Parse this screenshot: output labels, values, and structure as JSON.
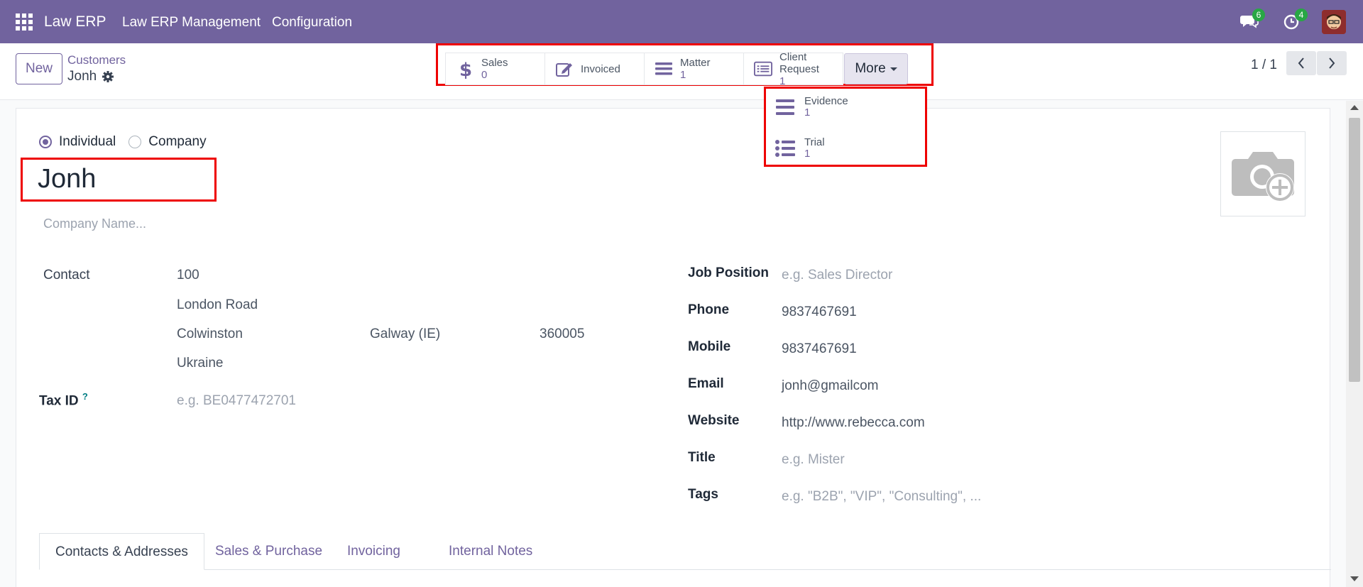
{
  "topnav": {
    "brand": "Law ERP",
    "menu": [
      "Law ERP Management",
      "Configuration"
    ],
    "messages_count": "6",
    "activities_count": "4"
  },
  "control_panel": {
    "new_label": "New",
    "breadcrumb_parent": "Customers",
    "breadcrumb_current": "Jonh",
    "pager": "1 / 1"
  },
  "smart_buttons": [
    {
      "label": "Sales",
      "count": "0",
      "icon": "dollar-icon"
    },
    {
      "label": "Invoiced",
      "count": "",
      "icon": "pencil-square-icon"
    },
    {
      "label": "Matter",
      "count": "1",
      "icon": "bars-icon"
    },
    {
      "label": "Client Request",
      "count": "1",
      "icon": "list-alt-icon"
    }
  ],
  "more_label": "More",
  "dropdown": [
    {
      "label": "Evidence",
      "count": "1",
      "icon": "bars-icon"
    },
    {
      "label": "Trial",
      "count": "1",
      "icon": "list-ul-icon"
    }
  ],
  "form": {
    "type_options": [
      "Individual",
      "Company"
    ],
    "selected_type": "Individual",
    "name": "Jonh",
    "company_placeholder": "Company Name...",
    "contact_label": "Contact",
    "street": "100",
    "street2": "London Road",
    "city": "Colwinston",
    "state": "Galway (IE)",
    "zip": "360005",
    "country": "Ukraine",
    "tax_label": "Tax ID",
    "tax_help": "?",
    "tax_placeholder": "e.g. BE0477472701",
    "right_fields": [
      {
        "label": "Job Position",
        "value": "",
        "placeholder": "e.g. Sales Director"
      },
      {
        "label": "Phone",
        "value": "9837467691",
        "placeholder": ""
      },
      {
        "label": "Mobile",
        "value": "9837467691",
        "placeholder": ""
      },
      {
        "label": "Email",
        "value": "jonh@gmailcom",
        "placeholder": ""
      },
      {
        "label": "Website",
        "value": "http://www.rebecca.com",
        "placeholder": ""
      },
      {
        "label": "Title",
        "value": "",
        "placeholder": "e.g. Mister"
      },
      {
        "label": "Tags",
        "value": "",
        "placeholder": "e.g. \"B2B\", \"VIP\", \"Consulting\", ..."
      }
    ]
  },
  "tabs": [
    "Contacts & Addresses",
    "Sales & Purchase",
    "Invoicing",
    "Internal Notes"
  ],
  "active_tab": "Contacts & Addresses",
  "colors": {
    "brand": "#71639e",
    "highlight": "#e00000",
    "badge": "#28a745"
  }
}
